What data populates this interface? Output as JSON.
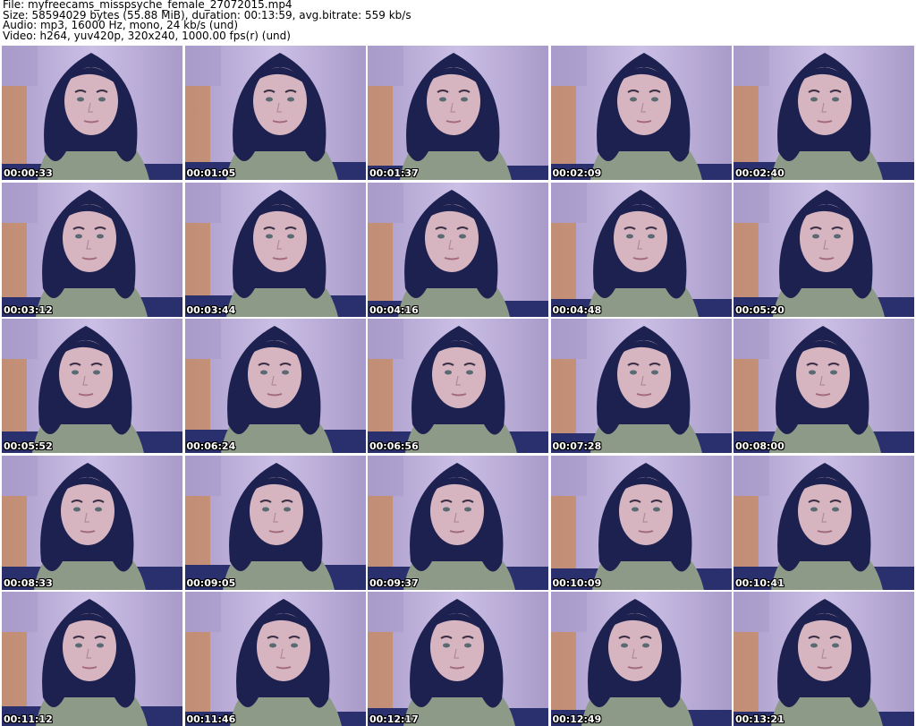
{
  "header": {
    "file_line": "File: myfreecams_misspsyche_female_27072015.mp4",
    "size_line": "Size: 58594029 bytes (55.88 MiB), duration: 00:13:59, avg.bitrate: 559 kb/s",
    "audio_line": "Audio: mp3, 16000 Hz, mono, 24 kb/s (und)",
    "video_line": "Video: h264, yuv420p, 320x240, 1000.00 fps(r) (und)"
  },
  "thumbnails": [
    {
      "timestamp": "00:00:33"
    },
    {
      "timestamp": "00:01:05"
    },
    {
      "timestamp": "00:01:37"
    },
    {
      "timestamp": "00:02:09"
    },
    {
      "timestamp": "00:02:40"
    },
    {
      "timestamp": "00:03:12"
    },
    {
      "timestamp": "00:03:44"
    },
    {
      "timestamp": "00:04:16"
    },
    {
      "timestamp": "00:04:48"
    },
    {
      "timestamp": "00:05:20"
    },
    {
      "timestamp": "00:05:52"
    },
    {
      "timestamp": "00:06:24"
    },
    {
      "timestamp": "00:06:56"
    },
    {
      "timestamp": "00:07:28"
    },
    {
      "timestamp": "00:08:00"
    },
    {
      "timestamp": "00:08:33"
    },
    {
      "timestamp": "00:09:05"
    },
    {
      "timestamp": "00:09:37"
    },
    {
      "timestamp": "00:10:09"
    },
    {
      "timestamp": "00:10:41"
    },
    {
      "timestamp": "00:11:12"
    },
    {
      "timestamp": "00:11:46"
    },
    {
      "timestamp": "00:12:17"
    },
    {
      "timestamp": "00:12:49"
    },
    {
      "timestamp": "00:13:21"
    }
  ],
  "colors": {
    "wall": "#cbbfe6",
    "wall_shadow": "#a99bc9",
    "hair": "#1d2150",
    "skin": "#d7b5c0",
    "shirt": "#8e9a88",
    "bed": "#2a2f6e",
    "headboard": "#c98a5a",
    "timestamp_text": "#ffffff"
  }
}
